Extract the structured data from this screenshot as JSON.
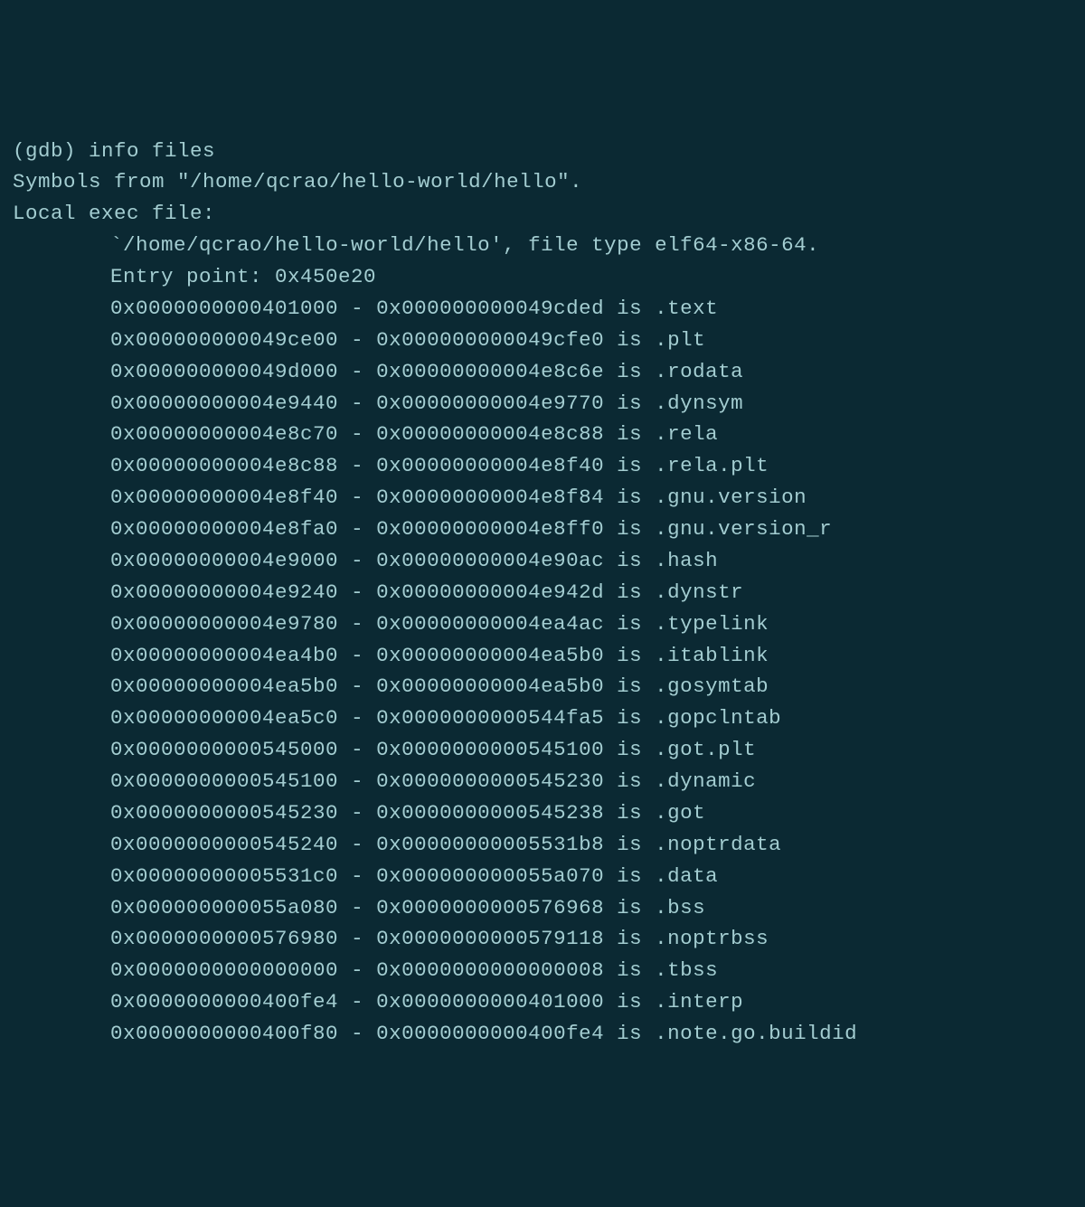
{
  "prompt": "(gdb) ",
  "command": "info files",
  "symbols_from_label": "Symbols from \"",
  "symbols_from_path": "/home/qcrao/hello-world/hello",
  "symbols_from_suffix": "\".",
  "local_exec_label": "Local exec file:",
  "exec_file_line_prefix": "`",
  "exec_file_path": "/home/qcrao/hello-world/hello",
  "exec_file_line_middle": "', file type ",
  "exec_file_type": "elf64-x86-64",
  "exec_file_line_suffix": ".",
  "entry_point_label": "Entry point: ",
  "entry_point": "0x450e20",
  "sections": [
    {
      "start": "0x0000000000401000",
      "dash": " - ",
      "end": "0x000000000049cded",
      "is": " is ",
      "name": ".text"
    },
    {
      "start": "0x000000000049ce00",
      "dash": " - ",
      "end": "0x000000000049cfe0",
      "is": " is ",
      "name": ".plt"
    },
    {
      "start": "0x000000000049d000",
      "dash": " - ",
      "end": "0x00000000004e8c6e",
      "is": " is ",
      "name": ".rodata"
    },
    {
      "start": "0x00000000004e9440",
      "dash": " - ",
      "end": "0x00000000004e9770",
      "is": " is ",
      "name": ".dynsym"
    },
    {
      "start": "0x00000000004e8c70",
      "dash": " - ",
      "end": "0x00000000004e8c88",
      "is": " is ",
      "name": ".rela"
    },
    {
      "start": "0x00000000004e8c88",
      "dash": " - ",
      "end": "0x00000000004e8f40",
      "is": " is ",
      "name": ".rela.plt"
    },
    {
      "start": "0x00000000004e8f40",
      "dash": " - ",
      "end": "0x00000000004e8f84",
      "is": " is ",
      "name": ".gnu.version"
    },
    {
      "start": "0x00000000004e8fa0",
      "dash": " - ",
      "end": "0x00000000004e8ff0",
      "is": " is ",
      "name": ".gnu.version_r"
    },
    {
      "start": "0x00000000004e9000",
      "dash": " - ",
      "end": "0x00000000004e90ac",
      "is": " is ",
      "name": ".hash"
    },
    {
      "start": "0x00000000004e9240",
      "dash": " - ",
      "end": "0x00000000004e942d",
      "is": " is ",
      "name": ".dynstr"
    },
    {
      "start": "0x00000000004e9780",
      "dash": " - ",
      "end": "0x00000000004ea4ac",
      "is": " is ",
      "name": ".typelink"
    },
    {
      "start": "0x00000000004ea4b0",
      "dash": " - ",
      "end": "0x00000000004ea5b0",
      "is": " is ",
      "name": ".itablink"
    },
    {
      "start": "0x00000000004ea5b0",
      "dash": " - ",
      "end": "0x00000000004ea5b0",
      "is": " is ",
      "name": ".gosymtab"
    },
    {
      "start": "0x00000000004ea5c0",
      "dash": " - ",
      "end": "0x0000000000544fa5",
      "is": " is ",
      "name": ".gopclntab"
    },
    {
      "start": "0x0000000000545000",
      "dash": " - ",
      "end": "0x0000000000545100",
      "is": " is ",
      "name": ".got.plt"
    },
    {
      "start": "0x0000000000545100",
      "dash": " - ",
      "end": "0x0000000000545230",
      "is": " is ",
      "name": ".dynamic"
    },
    {
      "start": "0x0000000000545230",
      "dash": " - ",
      "end": "0x0000000000545238",
      "is": " is ",
      "name": ".got"
    },
    {
      "start": "0x0000000000545240",
      "dash": " - ",
      "end": "0x00000000005531b8",
      "is": " is ",
      "name": ".noptrdata"
    },
    {
      "start": "0x00000000005531c0",
      "dash": " - ",
      "end": "0x000000000055a070",
      "is": " is ",
      "name": ".data"
    },
    {
      "start": "0x000000000055a080",
      "dash": " - ",
      "end": "0x0000000000576968",
      "is": " is ",
      "name": ".bss"
    },
    {
      "start": "0x0000000000576980",
      "dash": " - ",
      "end": "0x0000000000579118",
      "is": " is ",
      "name": ".noptrbss"
    },
    {
      "start": "0x0000000000000000",
      "dash": " - ",
      "end": "0x0000000000000008",
      "is": " is ",
      "name": ".tbss"
    },
    {
      "start": "0x0000000000400fe4",
      "dash": " - ",
      "end": "0x0000000000401000",
      "is": " is ",
      "name": ".interp"
    },
    {
      "start": "0x0000000000400f80",
      "dash": " - ",
      "end": "0x0000000000400fe4",
      "is": " is ",
      "name": ".note.go.buildid"
    }
  ]
}
